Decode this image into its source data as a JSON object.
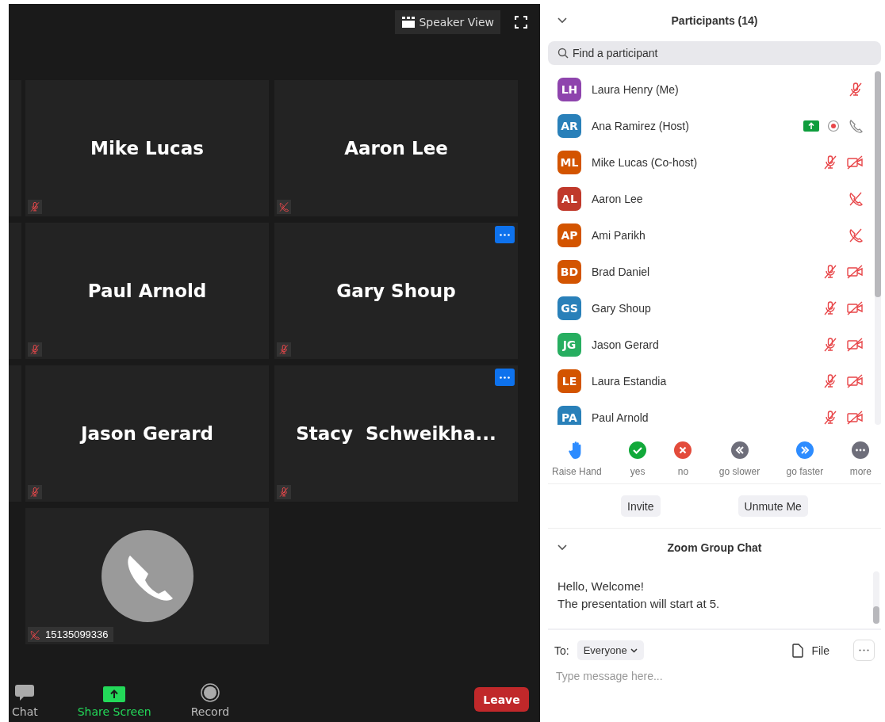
{
  "top_bar": {
    "view_button": "Speaker View"
  },
  "tiles": [
    {
      "kind": "video",
      "name": "Mike Lucas",
      "audio": {
        "kind": "micoff"
      },
      "menu": false
    },
    {
      "kind": "video",
      "name": "Aaron Lee",
      "audio": {
        "kind": "phoneoff"
      },
      "menu": false
    },
    {
      "kind": "video",
      "name": "Paul Arnold",
      "audio": {
        "kind": "micoff"
      },
      "menu": false
    },
    {
      "kind": "video",
      "name": "Gary Shoup",
      "audio": {
        "kind": "micoff"
      },
      "menu": true
    },
    {
      "kind": "video",
      "name": "Jason Gerard",
      "audio": {
        "kind": "micoff"
      },
      "menu": false
    },
    {
      "kind": "video",
      "name": "Stacy  Schweikha...",
      "audio": {
        "kind": "micoff"
      },
      "menu": true
    },
    {
      "kind": "phone",
      "name": "15135099336",
      "audio": {
        "kind": "phoneoff"
      },
      "menu": false
    }
  ],
  "toolbar": [
    {
      "label": "Chat",
      "kind": "chat"
    },
    {
      "label": "Share Screen",
      "kind": "share"
    },
    {
      "label": "Record",
      "kind": "record"
    }
  ],
  "leave_button": "Leave",
  "participants": {
    "title": "Participants (14)",
    "search": {
      "placeholder": "Find a participant"
    },
    "items": [
      {
        "initials": "LH",
        "color": "#8e44ad",
        "name": "Laura Henry (Me)",
        "icons": [
          {
            "kind": "micoff"
          }
        ]
      },
      {
        "initials": "AR",
        "color": "#2980b9",
        "name": "Ana Ramirez (Host)",
        "icons": [
          {
            "kind": "share"
          },
          {
            "kind": "record"
          },
          {
            "kind": "phone"
          }
        ]
      },
      {
        "initials": "ML",
        "color": "#d35400",
        "name": "Mike Lucas (Co-host)",
        "icons": [
          {
            "kind": "micoff"
          },
          {
            "kind": "videooff"
          }
        ]
      },
      {
        "initials": "AL",
        "color": "#c0392b",
        "name": "Aaron Lee",
        "icons": [
          {
            "kind": "phoneoff"
          }
        ]
      },
      {
        "initials": "AP",
        "color": "#d35400",
        "name": "Ami Parikh",
        "icons": [
          {
            "kind": "phoneoff"
          }
        ]
      },
      {
        "initials": "BD",
        "color": "#d35400",
        "name": "Brad Daniel",
        "icons": [
          {
            "kind": "micoff"
          },
          {
            "kind": "videooff"
          }
        ]
      },
      {
        "initials": "GS",
        "color": "#2980b9",
        "name": "Gary Shoup",
        "icons": [
          {
            "kind": "micoff"
          },
          {
            "kind": "videooff"
          }
        ]
      },
      {
        "initials": "JG",
        "color": "#27ae60",
        "name": "Jason Gerard",
        "icons": [
          {
            "kind": "micoff"
          },
          {
            "kind": "videooff"
          }
        ]
      },
      {
        "initials": "LE",
        "color": "#d35400",
        "name": "Laura Estandia",
        "icons": [
          {
            "kind": "micoff"
          },
          {
            "kind": "videooff"
          }
        ]
      },
      {
        "initials": "PA",
        "color": "#2980b9",
        "name": "Paul Arnold",
        "icons": [
          {
            "kind": "micoff"
          },
          {
            "kind": "videooff"
          }
        ]
      }
    ],
    "reactions": [
      {
        "label": "Raise Hand",
        "kind": "hand"
      },
      {
        "label": "yes",
        "kind": "yes"
      },
      {
        "label": "no",
        "kind": "no"
      },
      {
        "label": "go slower",
        "kind": "slower"
      },
      {
        "label": "go faster",
        "kind": "faster"
      },
      {
        "label": "more",
        "kind": "more"
      }
    ],
    "buttons": [
      "Invite",
      "Unmute Me"
    ]
  },
  "chat": {
    "title": "Zoom Group Chat",
    "messages": [
      "Hello, Welcome!",
      "The presentation will start at 5."
    ],
    "to_label": "To:",
    "recipient": "Everyone",
    "file_button": "File",
    "input": {
      "placeholder": "Type message here..."
    }
  }
}
